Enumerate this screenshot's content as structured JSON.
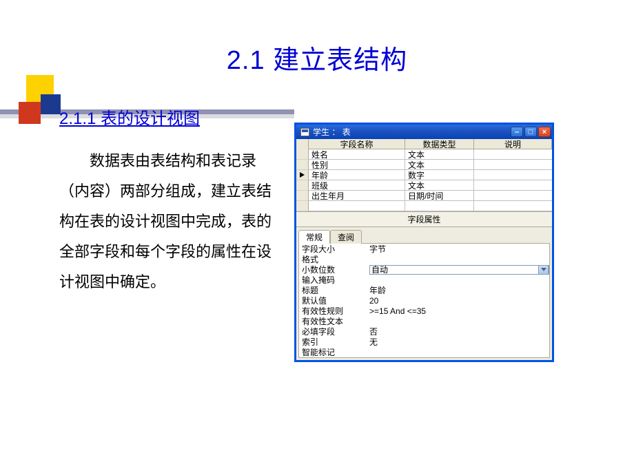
{
  "title": "2.1   建立表结构",
  "subtitle": "2.1.1   表的设计视图",
  "body_text": "数据表由表结构和表记录（内容）两部分组成，建立表结构在表的设计视图中完成，表的全部字段和每个字段的属性在设计视图中确定。",
  "window": {
    "caption": "学生  ：  表",
    "headers": {
      "name": "字段名称",
      "type": "数据类型",
      "desc": "说明"
    },
    "rows": [
      {
        "name": "姓名",
        "type": "文本",
        "current": false
      },
      {
        "name": "性别",
        "type": "文本",
        "current": false
      },
      {
        "name": "年龄",
        "type": "数字",
        "current": true
      },
      {
        "name": "班级",
        "type": "文本",
        "current": false
      },
      {
        "name": "出生年月",
        "type": "日期/时间",
        "current": false
      }
    ],
    "section_title": "字段属性",
    "tabs": {
      "general": "常规",
      "lookup": "查阅"
    },
    "props": [
      {
        "label": "字段大小",
        "value": "字节"
      },
      {
        "label": "格式",
        "value": ""
      },
      {
        "label": "小数位数",
        "value": "自动",
        "is_select": true
      },
      {
        "label": "输入掩码",
        "value": ""
      },
      {
        "label": "标题",
        "value": "年龄"
      },
      {
        "label": "默认值",
        "value": "20"
      },
      {
        "label": "有效性规则",
        "value": ">=15 And <=35"
      },
      {
        "label": "有效性文本",
        "value": ""
      },
      {
        "label": "必填字段",
        "value": "否"
      },
      {
        "label": "索引",
        "value": "无"
      },
      {
        "label": "智能标记",
        "value": ""
      }
    ],
    "btns": {
      "min": "–",
      "max": "□",
      "close": "×"
    }
  }
}
